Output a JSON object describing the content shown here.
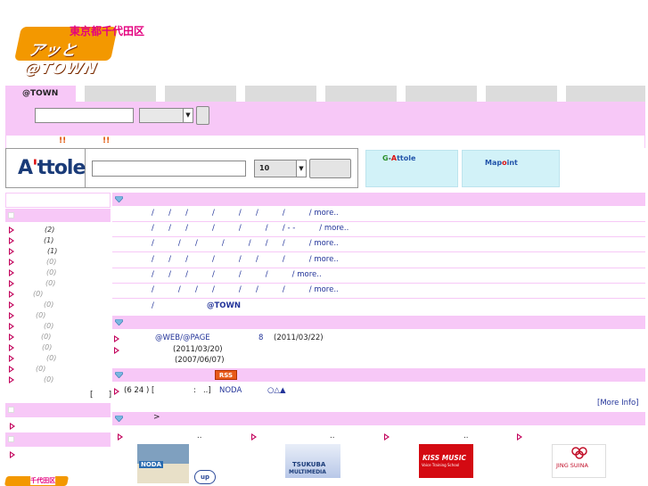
{
  "header": {
    "logo_mark": "アッと@TOWN",
    "logo_text": "東京都千代田区"
  },
  "tabs": [
    {
      "label": "@TOWN",
      "active": true
    },
    {
      "label": ""
    },
    {
      "label": ""
    },
    {
      "label": ""
    },
    {
      "label": ""
    },
    {
      "label": ""
    },
    {
      "label": ""
    },
    {
      "label": ""
    }
  ],
  "search": {
    "query_value": "",
    "select_value": "",
    "button_label": ""
  },
  "notice": {
    "mark1": "!!",
    "mark2": "!!"
  },
  "attole": {
    "logo_a": "A",
    "logo_apos": "'",
    "logo_rest": "ttole",
    "query_value": "",
    "count_select": "10",
    "button_label": "",
    "gattole": {
      "g": "G",
      "dash": "-",
      "a": "A",
      "rest": "ttole"
    },
    "mapoint": {
      "pre": "Map",
      "o": "o",
      "rest": "int"
    }
  },
  "sidebar": {
    "counts": [
      "(2)",
      "(1)",
      "(1)",
      "(0)",
      "(0)",
      "(0)",
      "(0)",
      "(0)",
      "(0)",
      "(0)",
      "(0)",
      "(0)",
      "(0)",
      "(0)",
      "(0)"
    ],
    "bracket": "[      ]"
  },
  "main": {
    "category_rows": [
      {
        "text": "/      /      /          /          /      /          /          / more.."
      },
      {
        "text": "/      /      /          /          /          /      / - -          / more.."
      },
      {
        "text": "/          /      /          /          /      /      /          / more.."
      },
      {
        "text": "/      /      /          /          /      /          /          / more.."
      },
      {
        "text": "/      /      /          /          /          /          / more.."
      },
      {
        "text": "/          /      /      /          /      /          /          / more.."
      }
    ],
    "atown_row": {
      "slash": "/",
      "label": "@TOWN"
    },
    "news": [
      {
        "title": "@WEB/@PAGE",
        "num": "8",
        "date": "(2011/03/22)"
      },
      {
        "title": "",
        "num": "",
        "date": "(2011/03/20)"
      },
      {
        "title": "",
        "num": "",
        "date": "(2007/06/07)"
      }
    ],
    "rss_label": "RSS",
    "rss_item": {
      "prefix": "(6 24 ) [",
      "mid": ":   ..]",
      "noda": "NODA",
      "shapes": "○△▲"
    },
    "more_info": "[More Info]",
    "section4_arrow": ">",
    "ad_dots": [
      "..",
      "..",
      ".."
    ],
    "banners": [
      {
        "label": "NODA",
        "sub": ""
      },
      {
        "label": "TSUKUBA",
        "sub": "MULTIMEDIA"
      },
      {
        "label": "KISS MUSIC",
        "sub": "Voice Training School"
      },
      {
        "label": "JING SUINA",
        "sub": ""
      }
    ],
    "up_label": "up",
    "footer_logo": "千代田区"
  },
  "colors": {
    "pink": "#f7c8f7",
    "tab_grey": "#dcdcdc",
    "link": "#223399",
    "arrow": "#c2005b",
    "card": "#d2f2f8"
  }
}
